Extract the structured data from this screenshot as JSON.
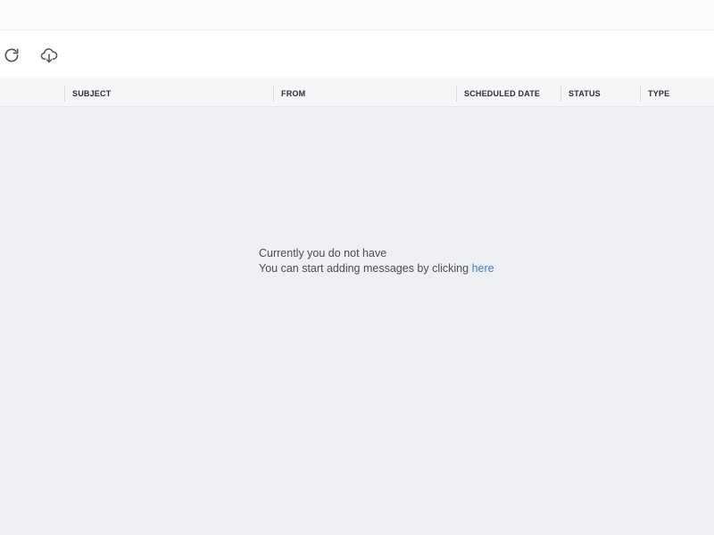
{
  "toolbar": {
    "refresh_icon": "refresh-icon",
    "download_icon": "cloud-download-icon"
  },
  "table": {
    "columns": [
      "SUBJECT",
      "FROM",
      "SCHEDULED DATE",
      "STATUS",
      "TYPE"
    ]
  },
  "empty_state": {
    "line1": "Currently you do not have",
    "line2": "You can start adding messages by clicking",
    "link": "here"
  },
  "colors": {
    "link": "#3d7fcc",
    "background": "#eef0f4"
  }
}
